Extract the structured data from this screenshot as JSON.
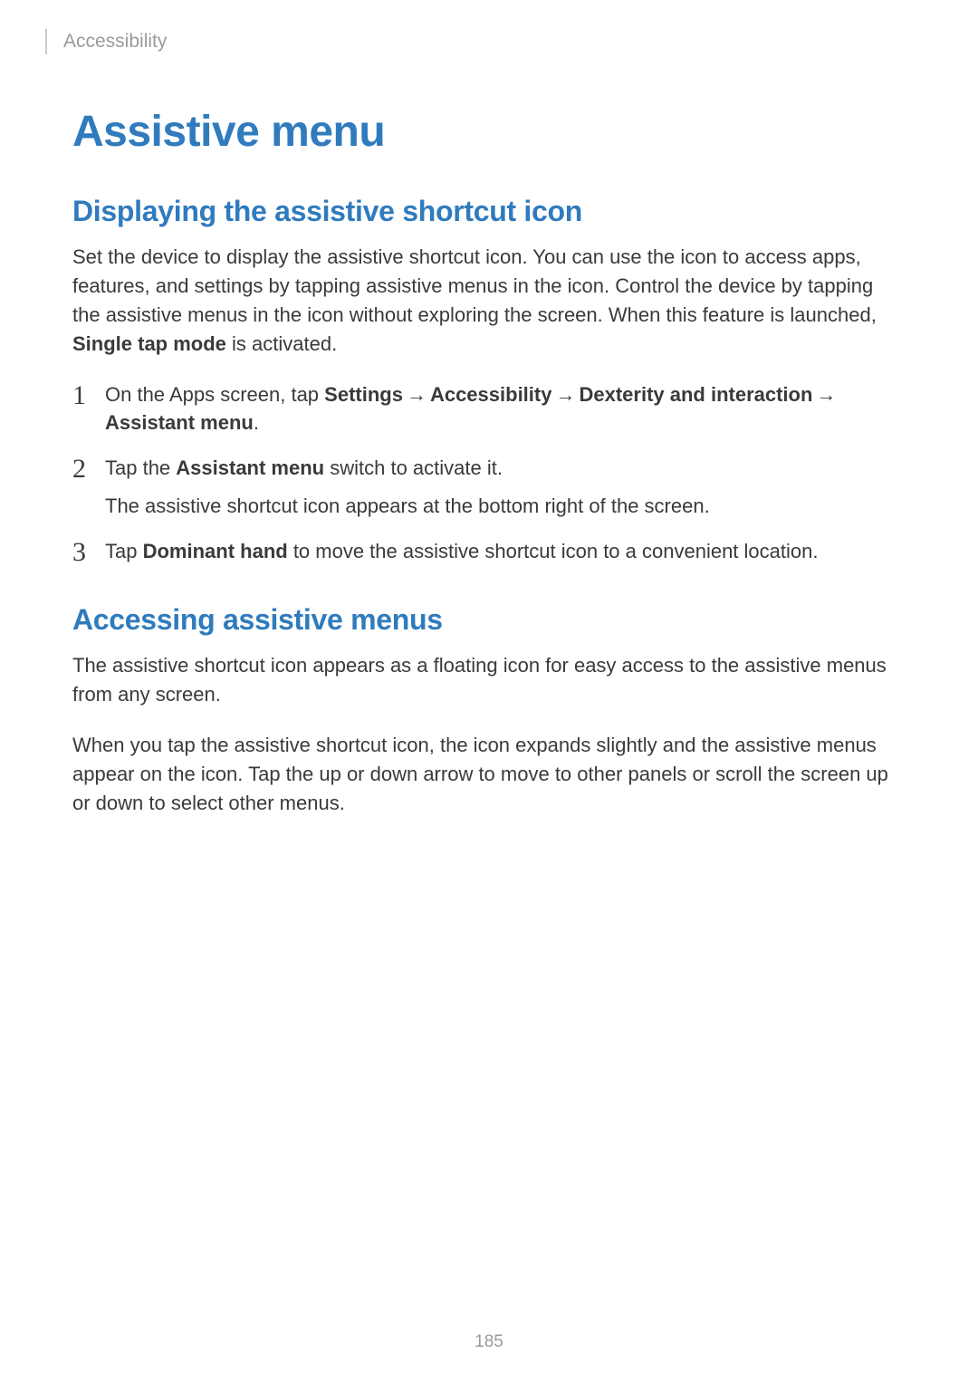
{
  "breadcrumb": "Accessibility",
  "title": "Assistive menu",
  "section1": {
    "heading": "Displaying the assistive shortcut icon",
    "intro_pre": "Set the device to display the assistive shortcut icon. You can use the icon to access apps, features, and settings by tapping assistive menus in the icon. Control the device by tapping the assistive menus in the icon without exploring the screen. When this feature is launched, ",
    "intro_bold": "Single tap mode",
    "intro_post": " is activated.",
    "steps": [
      {
        "num": "1",
        "pre": "On the Apps screen, tap ",
        "bold_path": [
          "Settings",
          "Accessibility",
          "Dexterity and interaction",
          "Assistant menu"
        ],
        "post": "."
      },
      {
        "num": "2",
        "line1_pre": "Tap the ",
        "line1_bold": "Assistant menu",
        "line1_post": " switch to activate it.",
        "line2": "The assistive shortcut icon appears at the bottom right of the screen."
      },
      {
        "num": "3",
        "pre": "Tap ",
        "bold": "Dominant hand",
        "post": " to move the assistive shortcut icon to a convenient location."
      }
    ]
  },
  "section2": {
    "heading": "Accessing assistive menus",
    "p1": "The assistive shortcut icon appears as a floating icon for easy access to the assistive menus from any screen.",
    "p2": "When you tap the assistive shortcut icon, the icon expands slightly and the assistive menus appear on the icon. Tap the up or down arrow to move to other panels or scroll the screen up or down to select other menus."
  },
  "arrow_glyph": "→",
  "page_number": "185"
}
